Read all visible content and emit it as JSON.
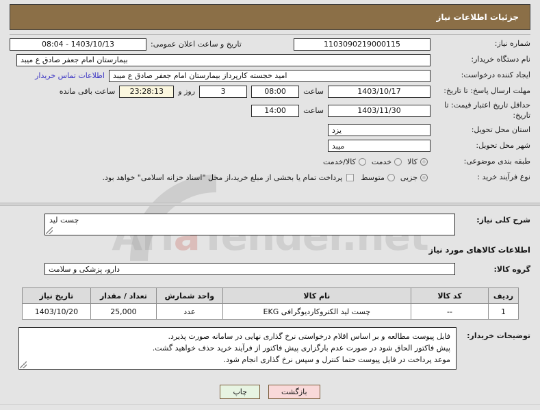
{
  "header": {
    "title": "جزئیات اطلاعات نیاز"
  },
  "info": {
    "need_number_label": "شماره نیاز:",
    "need_number": "1103090219000115",
    "announce_label": "تاریخ و ساعت اعلان عمومی:",
    "announce_value": "1403/10/13 - 08:04",
    "buyer_org_label": "نام دستگاه خریدار:",
    "buyer_org": "بیمارستان امام جعفر صادق  ع  میبد",
    "creator_label": "ایجاد کننده درخواست:",
    "creator": "امید خجسته کارپرداز بیمارستان امام جعفر صادق  ع  میبد",
    "contact_link": "اطلاعات تماس خریدار",
    "deadline_label": "مهلت ارسال پاسخ: تا تاریخ:",
    "deadline_date": "1403/10/17",
    "hour_label": "ساعت",
    "deadline_time": "08:00",
    "remaining_days": "3",
    "days_word": "روز و",
    "remaining_clock": "23:28:13",
    "remaining_tail": "ساعت باقی مانده",
    "validity_label": "حداقل تاریخ اعتبار قیمت: تا تاریخ:",
    "validity_date": "1403/11/30",
    "validity_time": "14:00",
    "province_label": "استان محل تحویل:",
    "province": "یزد",
    "city_label": "شهر محل تحویل:",
    "city": "میبد",
    "category_label": "طبقه بندی موضوعی:",
    "category_options": [
      "کالا",
      "خدمت",
      "کالا/خدمت"
    ],
    "category_selected": "کالا",
    "process_label": "نوع فرآیند خرید :",
    "process_options": [
      "جزیی",
      "متوسط"
    ],
    "process_selected": "جزیی",
    "treasury_checkbox_text": "پرداخت تمام یا بخشی از مبلغ خرید،از محل \"اسناد خزانه اسلامی\" خواهد بود.",
    "treasury_checked": false
  },
  "description": {
    "label": "شرح کلی نیاز:",
    "value": "چست لید"
  },
  "goods_section": {
    "title": "اطلاعات کالاهای مورد نیاز",
    "group_label": "گروه کالا:",
    "group_value": "دارو، پزشکی و سلامت"
  },
  "table": {
    "headers": [
      "ردیف",
      "کد کالا",
      "نام کالا",
      "واحد شمارش",
      "تعداد / مقدار",
      "تاریخ نیاز"
    ],
    "rows": [
      {
        "radif": "1",
        "code": "--",
        "name": "چست لید الکتروکاردیوگرافی EKG",
        "unit": "عدد",
        "qty": "25,000",
        "date": "1403/10/20"
      }
    ]
  },
  "notes": {
    "label": "توضیحات خریدار:",
    "line1": "فایل پیوست مطالعه و بر اساس اقلام درخواستی نرخ گذاری نهایی در سامانه صورت پذیرد.",
    "line2": "پیش فاکتور الحاق شود در صورت عدم بارگزاری پیش فاکتور از فرآیند خرید حذف خواهید گشت.",
    "line3": "موعد پرداخت در فایل پیوست حتما کنترل و سپس نرخ گذاری انجام شود."
  },
  "buttons": {
    "print": "چاپ",
    "back": "بازگشت"
  },
  "watermark": {
    "text_left": "Ari",
    "text_accent": "a",
    "text_right": "Tender.net"
  },
  "colors": {
    "header_bg": "#8b6f47",
    "link": "#3d37c4",
    "print_btn": "#e7f4e2",
    "back_btn": "#f9d9d9",
    "clock_bg": "#fbf7df"
  }
}
